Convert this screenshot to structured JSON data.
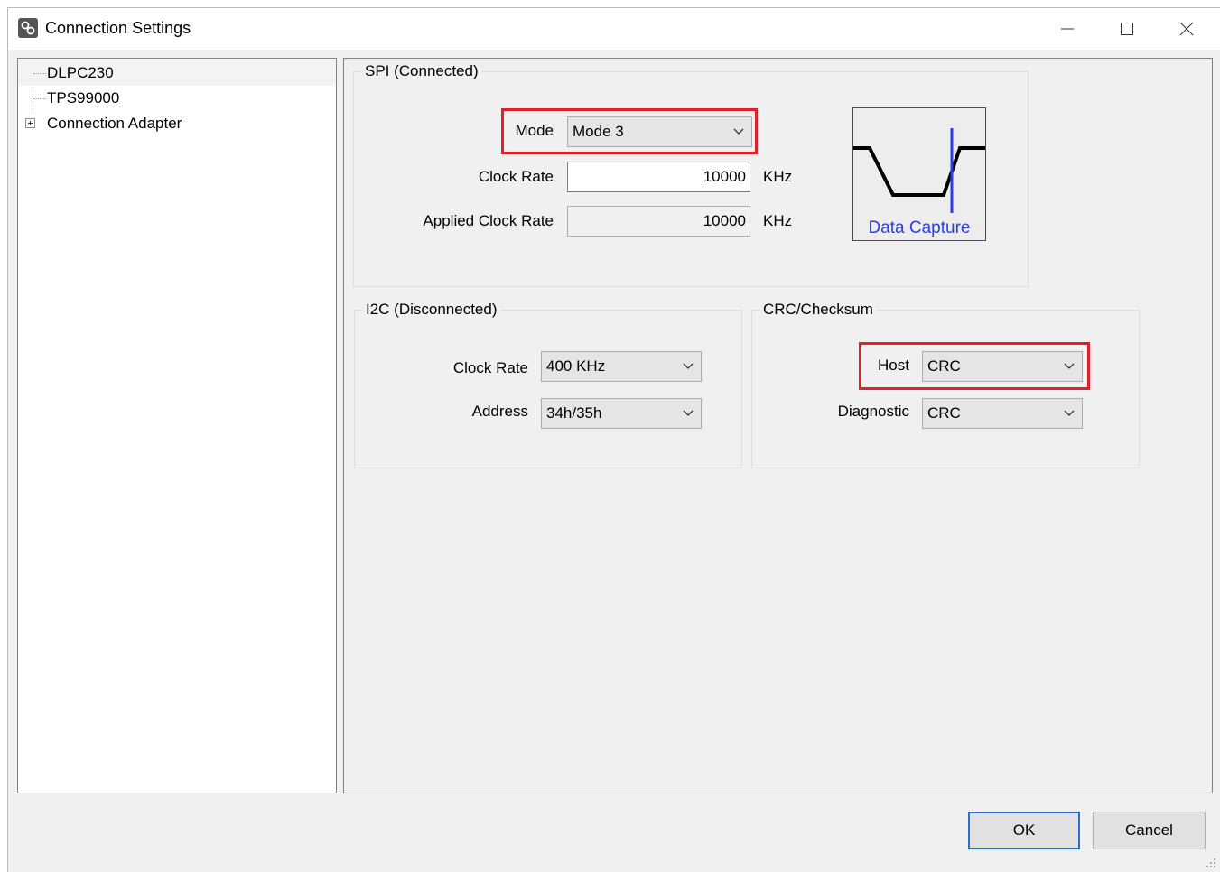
{
  "window": {
    "title": "Connection Settings"
  },
  "tree": {
    "items": [
      {
        "label": "DLPC230",
        "selected": true
      },
      {
        "label": "TPS99000",
        "selected": false
      },
      {
        "label": "Connection Adapter",
        "selected": false,
        "expandable": true
      }
    ]
  },
  "spi": {
    "legend": "SPI (Connected)",
    "mode_label": "Mode",
    "mode_value": "Mode 3",
    "clock_rate_label": "Clock Rate",
    "clock_rate_value": "10000",
    "clock_rate_unit": "KHz",
    "applied_clock_rate_label": "Applied Clock Rate",
    "applied_clock_rate_value": "10000",
    "applied_clock_rate_unit": "KHz",
    "capture_label": "Data Capture"
  },
  "i2c": {
    "legend": "I2C (Disconnected)",
    "clock_rate_label": "Clock Rate",
    "clock_rate_value": "400 KHz",
    "address_label": "Address",
    "address_value": "34h/35h"
  },
  "crc": {
    "legend": "CRC/Checksum",
    "host_label": "Host",
    "host_value": "CRC",
    "diagnostic_label": "Diagnostic",
    "diagnostic_value": "CRC"
  },
  "buttons": {
    "ok_label": "OK",
    "cancel_label": "Cancel"
  },
  "colors": {
    "highlight": "#e0202a",
    "capture_signal": "#2a3fe0",
    "default_button_border": "#2a6ec9"
  }
}
